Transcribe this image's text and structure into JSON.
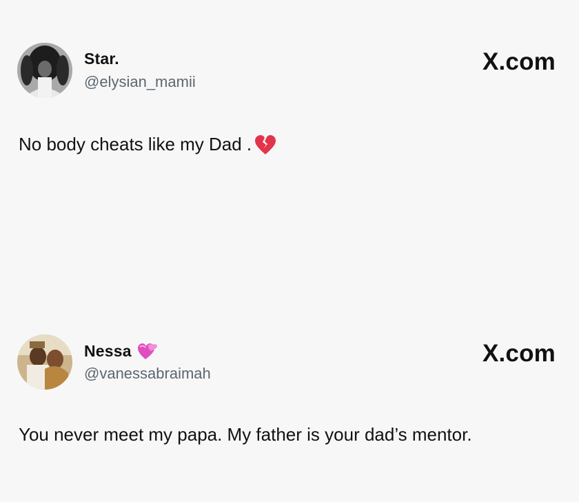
{
  "posts": [
    {
      "display_name": "Star.",
      "handle": "@elysian_mamii",
      "brand": "X.com",
      "text": "No body cheats like my Dad .",
      "trailing_emoji": "broken-heart-icon",
      "avatar": "woman-hands-on-head-photo"
    },
    {
      "display_name": "Nessa",
      "name_emoji": "heart-with-ribbon-icon",
      "handle": "@vanessabraimah",
      "brand": "X.com",
      "text": "You never meet my papa. My father is your dad’s mentor.",
      "avatar": "couple-photo"
    }
  ],
  "colors": {
    "background": "#f7f7f7",
    "handle_gray": "#5b6670",
    "broken_heart": "#e2344a",
    "pink_heart": "#e04fc0"
  }
}
